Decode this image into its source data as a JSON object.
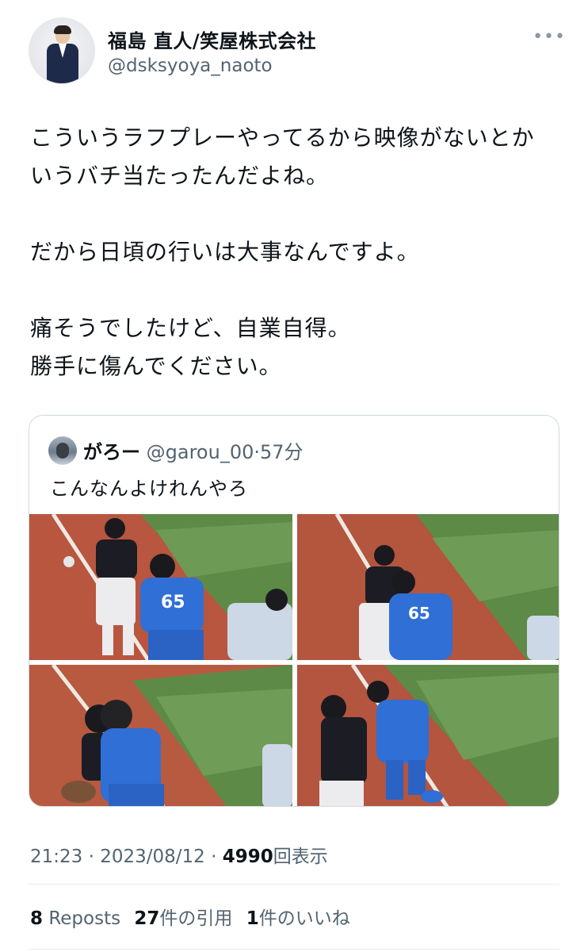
{
  "author": {
    "name": "福島 直人/笑屋株式会社",
    "handle": "@dsksyoya_naoto",
    "more_icon": "•••"
  },
  "tweet": {
    "lines": [
      "こういうラフプレーやってるから映像がないとか",
      "いうバチ当たったんだよね。",
      "",
      "だから日頃の行いは大事なんですよ。",
      "",
      "痛そうでしたけど、自業自得。",
      "勝手に傷んでください。"
    ]
  },
  "quoted": {
    "name": "がろー",
    "handle": "@garou_00",
    "separator": "·",
    "time": "57分",
    "text": "こんなんよけれんやろ"
  },
  "meta": {
    "time": "21:23",
    "separator": "·",
    "date": "2023/08/12",
    "separator2": "·",
    "views": "4990",
    "views_label": "回表示"
  },
  "stats": {
    "reposts_count": "8",
    "reposts_label": "Reposts",
    "quotes_count": "27",
    "quotes_label": "件の引用",
    "likes_count": "1",
    "likes_label": "件のいいね"
  },
  "colors": {
    "text": "#0f1419",
    "secondary": "#536471",
    "border": "#cfd9de",
    "field_clay": "#b5533d",
    "field_grass": "#5d8a4a",
    "catcher_blue": "#2f6fd6"
  }
}
